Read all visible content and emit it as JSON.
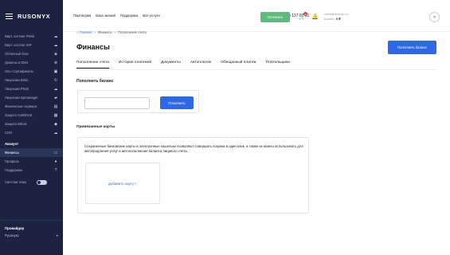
{
  "sidebar": {
    "logo": "RUSONYX",
    "items": [
      {
        "label": "Вирт. хостинг Plesk",
        "icon": "cloud-gear-icon"
      },
      {
        "label": "Вирт. хостинг ISP",
        "icon": "cloud-icon"
      },
      {
        "label": "Облачный бокс",
        "icon": "layers-icon"
      },
      {
        "label": "Домены и DNS",
        "icon": "globe-icon"
      },
      {
        "label": "SSL-Сертификаты",
        "icon": "lock-icon"
      },
      {
        "label": "Лицензии Bitrix",
        "icon": "refresh-icon"
      },
      {
        "label": "Лицензии Plesk",
        "icon": "cloud-icon"
      },
      {
        "label": "Лицензии ispmanager",
        "icon": "stripes-icon"
      },
      {
        "label": "Физические сервера",
        "icon": "server-icon"
      },
      {
        "label": "Защита AntiDDoS",
        "icon": "grid-icon"
      },
      {
        "label": "Защита Whois",
        "icon": "shield-icon"
      },
      {
        "label": "CDN",
        "icon": "cloud-network-icon"
      }
    ],
    "account_title": "Аккаунт",
    "account_items": [
      {
        "label": "Финансы",
        "icon": "wallet-icon",
        "active": true
      },
      {
        "label": "Профиль",
        "icon": "person-icon"
      },
      {
        "label": "Поддержка",
        "icon": "help-icon"
      }
    ],
    "theme_label": "Светлая тема",
    "provider_title": "Провайдер",
    "provider_value": "Русонукс"
  },
  "header": {
    "nav": [
      "Партнерам",
      "База знаний",
      "Поддержка",
      "Все услуги"
    ],
    "phone": "+7 (495) 137 07 01",
    "pay_button": "Оплатить",
    "cart_badge": "0",
    "user_email": "client@rusonyx.ru",
    "balance_label": "Баланс:",
    "balance_value": "0 ₽"
  },
  "breadcrumb": {
    "home": "Главная",
    "items": [
      "Финансы",
      "Пополнение счета"
    ]
  },
  "page_title": "Финансы",
  "top_button": "Пополнить баланс",
  "tabs": [
    {
      "label": "Пополнение счета",
      "active": true
    },
    {
      "label": "История платежей"
    },
    {
      "label": "Документы"
    },
    {
      "label": "Автоплатеж"
    },
    {
      "label": "Обещанный платеж"
    },
    {
      "label": "Плательщики"
    }
  ],
  "topup": {
    "title": "Пополнить баланс",
    "placeholder": "",
    "button": "Пополнить"
  },
  "cards": {
    "title": "Привязанные карты",
    "description": "Сохраненные банковские карты и электронные кошельки позволяют совершать покупки в один клик, а также их можно использовать для автопродления услуг и автопополнения баланса лицевого счета.",
    "add_label": "Добавить карту +"
  }
}
